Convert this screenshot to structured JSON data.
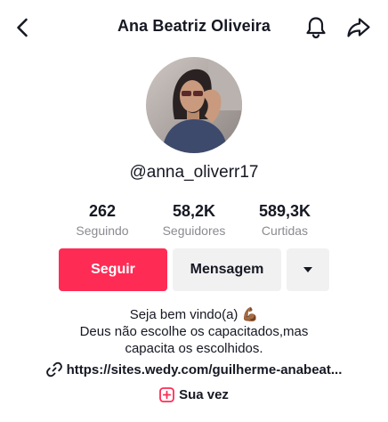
{
  "header": {
    "title": "Ana Beatriz Oliveira",
    "back_icon": "chevron-left-icon",
    "bell_icon": "bell-icon",
    "share_icon": "share-arrow-icon"
  },
  "profile": {
    "username": "@anna_oliverr17",
    "avatar": "profile-photo"
  },
  "stats": [
    {
      "value": "262",
      "label": "Seguindo"
    },
    {
      "value": "58,2K",
      "label": "Seguidores"
    },
    {
      "value": "589,3K",
      "label": "Curtidas"
    }
  ],
  "actions": {
    "follow_label": "Seguir",
    "message_label": "Mensagem",
    "more_icon": "caret-down-icon"
  },
  "bio": {
    "line1": "Seja bem vindo(a) 💪🏾",
    "line2": "Deus não escolhe os capacitados,mas",
    "line3": "capacita os escolhidos."
  },
  "link": {
    "icon": "link-icon",
    "text": "https://sites.wedy.com/guilherme-anabeat..."
  },
  "turn": {
    "icon": "add-square-icon",
    "text": "Sua vez"
  },
  "colors": {
    "accent": "#fe2c55",
    "secondary_button": "#f1f1f2",
    "muted_text": "#8a8b91",
    "text": "#161823"
  }
}
